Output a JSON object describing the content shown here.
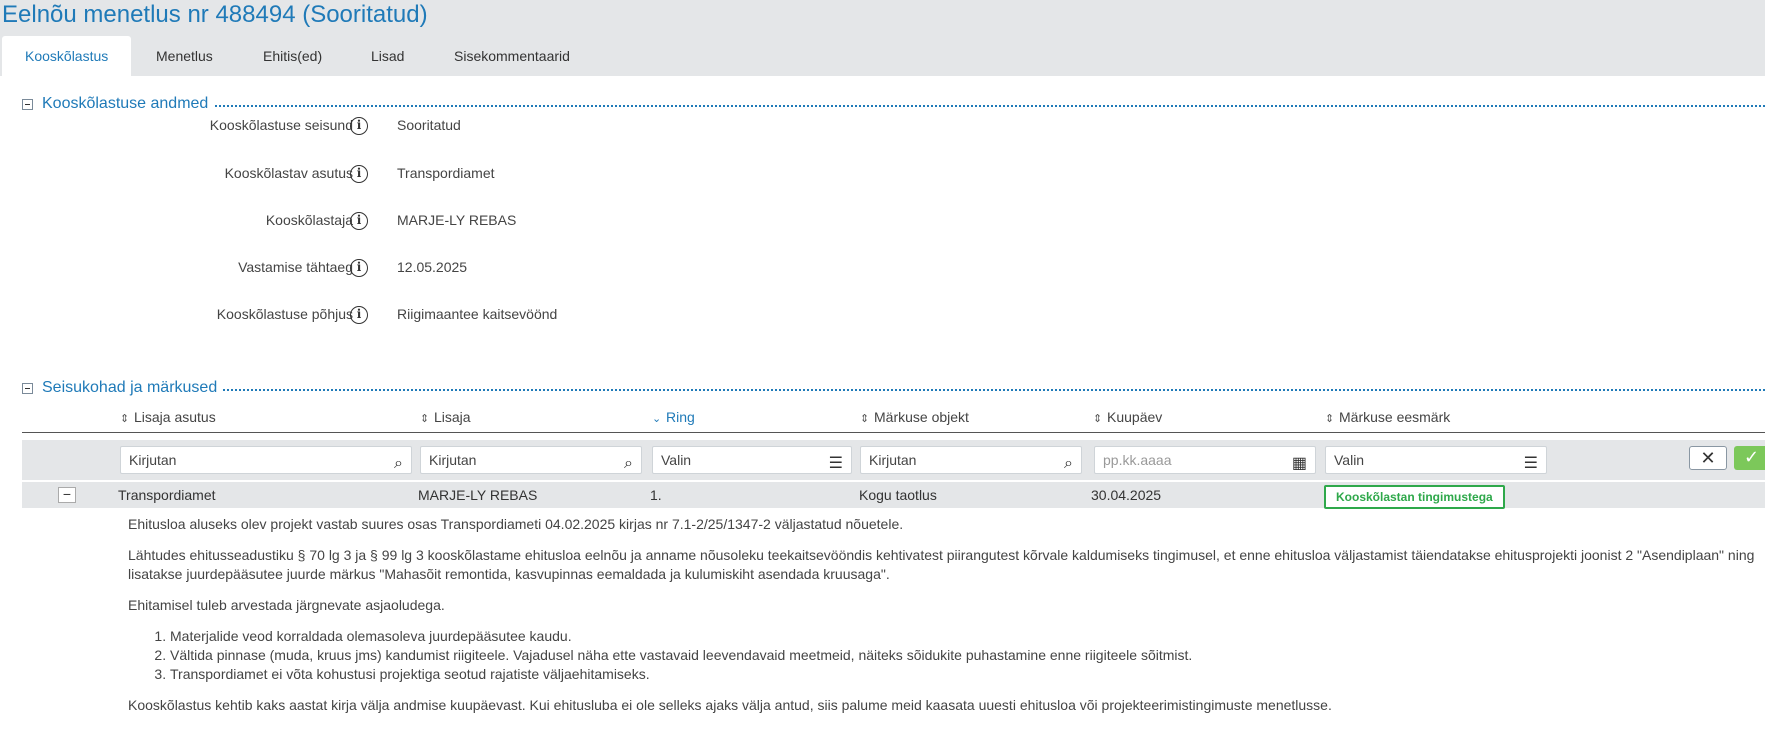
{
  "page_title": "Eelnõu menetlus nr 488494 (Sooritatud)",
  "tabs": [
    {
      "label": "Kooskõlastus",
      "active": true
    },
    {
      "label": "Menetlus",
      "active": false
    },
    {
      "label": "Ehitis(ed)",
      "active": false
    },
    {
      "label": "Lisad",
      "active": false
    },
    {
      "label": "Sisekommentaarid",
      "active": false
    }
  ],
  "section1": {
    "title": "Kooskõlastuse andmed",
    "fields": [
      {
        "label": "Kooskõlastuse seisund",
        "value": "Sooritatud"
      },
      {
        "label": "Kooskõlastav asutus",
        "value": "Transpordiamet"
      },
      {
        "label": "Kooskõlastaja",
        "value": "MARJE-LY REBAS"
      },
      {
        "label": "Vastamise tähtaeg",
        "value": "12.05.2025"
      },
      {
        "label": "Kooskõlastuse põhjus",
        "value": "Riigimaantee kaitsevöönd"
      }
    ]
  },
  "section2": {
    "title": "Seisukohad ja märkused",
    "columns": [
      {
        "label": "Lisaja asutus"
      },
      {
        "label": "Lisaja"
      },
      {
        "label": "Ring"
      },
      {
        "label": "Märkuse objekt"
      },
      {
        "label": "Kuupäev"
      },
      {
        "label": "Märkuse eesmärk"
      }
    ],
    "filters": [
      {
        "value": "Kirjutan"
      },
      {
        "value": "Kirjutan"
      },
      {
        "value": "Valin"
      },
      {
        "value": "Kirjutan"
      },
      {
        "placeholder": "pp.kk.aaaa"
      },
      {
        "value": "Valin"
      }
    ],
    "row": {
      "lisaja_asutus": "Transpordiamet",
      "lisaja": "MARJE-LY REBAS",
      "ring": "1.",
      "markuse_objekt": "Kogu taotlus",
      "kuupaev": "30.04.2025",
      "eesmark": "Kooskõlastan tingimustega"
    },
    "detail": {
      "p1": "Ehitusloa aluseks olev projekt vastab suures osas Transpordiameti 04.02.2025 kirjas nr 7.1-2/25/1347-2 väljastatud nõuetele.",
      "p2": "Lähtudes ehitusseadustiku § 70 lg 3 ja § 99 lg 3 kooskõlastame ehitusloa eelnõu ja anname nõusoleku teekaitsevööndis kehtivatest piirangutest kõrvale kaldumiseks tingimusel, et enne ehitusloa väljastamist täiendatakse ehitusprojekti joonist 2 \"Asendiplaan\" ning lisatakse juurdepääsutee juurde märkus \"Mahasõit remontida, kasvupinnas eemaldada ja kulumiskiht asendada kruusaga\".",
      "p3": "Ehitamisel tuleb arvestada järgnevate asjaoludega.",
      "list": [
        "Materjalide veod korraldada olemasoleva juurdepääsutee kaudu.",
        "Vältida pinnase (muda, kruus jms) kandumist riigiteele. Vajadusel näha ette vastavaid leevendavaid meetmeid, näiteks sõidukite puhastamine enne riigiteele sõitmist.",
        "Transpordiamet ei võta kohustusi projektiga seotud rajatiste väljaehitamiseks."
      ],
      "p4": "Kooskõlastus kehtib kaks aastat kirja välja andmise kuupäevast. Kui ehitusluba ei ole selleks ajaks välja antud, siis palume meid kaasata uuesti ehitusloa või projekteerimistingimuste menetlusse."
    }
  },
  "colors": {
    "accent": "#1f7ab8",
    "badge": "#2ea84a",
    "ok_button": "#7cc85a"
  }
}
